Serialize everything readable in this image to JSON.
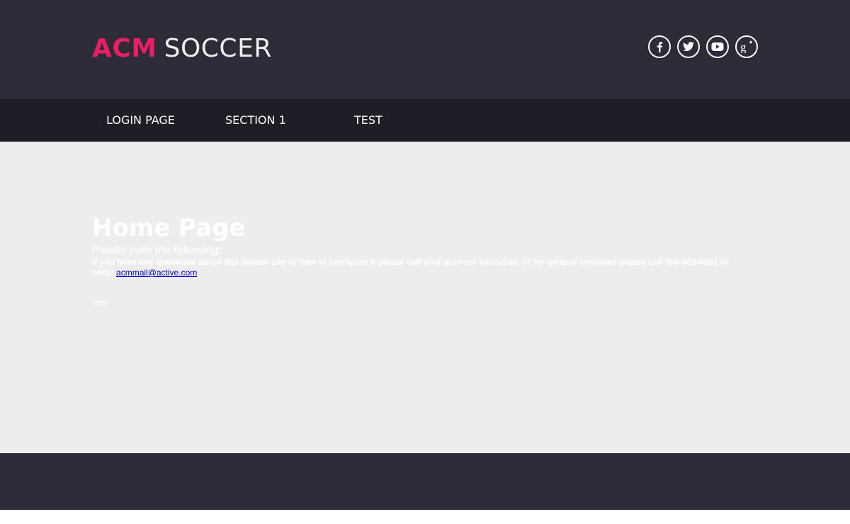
{
  "header": {
    "logo_accent": "ACM",
    "logo_main": "SOCCER",
    "social": [
      {
        "icon": "facebook-icon"
      },
      {
        "icon": "twitter-icon"
      },
      {
        "icon": "youtube-icon"
      },
      {
        "icon": "google-plus-icon"
      }
    ]
  },
  "nav": {
    "items": [
      {
        "label": "LOGIN PAGE"
      },
      {
        "label": "SECTION 1"
      },
      {
        "label": "TEST"
      }
    ]
  },
  "main": {
    "title": "Home Page",
    "note_heading": "Please note the following:",
    "note_text": "If you have any questions about this default site or how to configure it please call your account executive, or for general enquiries please call 800-663-4991 or email",
    "email_link": "acmmail@active.com",
    "test_text": "Test"
  },
  "colors": {
    "header_bg": "#2d2b36",
    "nav_bg": "#1f1e27",
    "accent": "#e91e63",
    "main_bg": "#ededed",
    "link": "#0000cc"
  }
}
